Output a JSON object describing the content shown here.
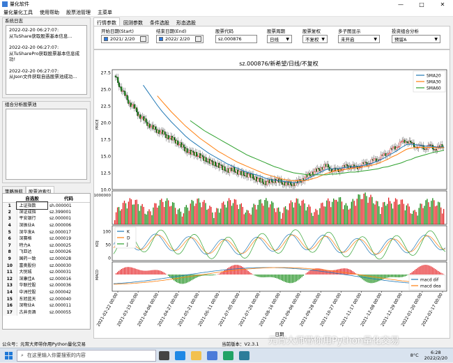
{
  "window": {
    "title": "量化软件",
    "min": "—",
    "max": "□",
    "close": "✕"
  },
  "menu": [
    "量化量化工具",
    "使用帮助",
    "股票池管理",
    "主菜单"
  ],
  "log_panel": {
    "title": "系统日志",
    "entries": [
      {
        "time": "2022-02-20 06:27:07:",
        "msg": "从TuShare获取股票基本信息..."
      },
      {
        "time": "2022-02-20 06:27:07:",
        "msg": "从TuSharePro获取股票基本信息成功!"
      },
      {
        "time": "2022-02-20 06:27:07:",
        "msg": "从Json文件获取自选股票池成功..."
      }
    ]
  },
  "combo_panel": {
    "title": "组合分析股票池"
  },
  "left_tabs": [
    "策略导航",
    "股票池索引"
  ],
  "stock_table": {
    "headers": [
      "",
      "自选股",
      "代码"
    ],
    "rows": [
      [
        "1",
        "上证指数",
        "sh.000001"
      ],
      [
        "2",
        "深证成指",
        "sz.399001"
      ],
      [
        "3",
        "平安银行",
        "sz.000001"
      ],
      [
        "4",
        "深振业A",
        "sz.000006"
      ],
      [
        "5",
        "深华发A",
        "sz.000017"
      ],
      [
        "6",
        "深赛格",
        "sz.000019"
      ],
      [
        "7",
        "特力A",
        "sz.000025"
      ],
      [
        "8",
        "飞亚达",
        "sz.000026"
      ],
      [
        "9",
        "国药一致",
        "sz.000028"
      ],
      [
        "10",
        "富奥股份",
        "sz.000030"
      ],
      [
        "11",
        "大悦城",
        "sz.000031"
      ],
      [
        "12",
        "深康佳A",
        "sz.000016"
      ],
      [
        "13",
        "华联控股",
        "sz.000036"
      ],
      [
        "14",
        "中洲控股",
        "sz.000042"
      ],
      [
        "15",
        "东旭蓝天",
        "sz.000040"
      ],
      [
        "16",
        "深物业A",
        "sz.000011"
      ],
      [
        "17",
        "古井贡酒",
        "sz.000055"
      ]
    ]
  },
  "main_tabs": [
    "行情参数",
    "回测参数",
    "条件选股",
    "形态选股"
  ],
  "controls": {
    "start_label": "开始日期(Start)",
    "start_value": "2021/ 2/20",
    "end_label": "结束日期(End)",
    "end_value": "2022/ 2/20",
    "code_label": "股票代码",
    "code_value": "sz.000876",
    "period_label": "股票周期",
    "period_value": "日线",
    "adjust_label": "股票复权",
    "adjust_value": "不复权",
    "multi_label": "多子图显示",
    "multi_value": "未开启",
    "portfolio_label": "投资组合分析",
    "portfolio_value": "预留A"
  },
  "chart_data": {
    "type": "line",
    "title": "sz.000876/新希望/日线/不复权",
    "xlabel": "日期",
    "price_ylabel": "PRICE",
    "kdj_ylabel": "KDJ",
    "macd_ylabel": "MACD",
    "x_ticks": [
      "2021-02-22 00:00",
      "2021-03-15 00:00",
      "2021-04-06 00:00",
      "2021-04-27 00:00",
      "2021-05-21 00:00",
      "2021-06-11 00:00",
      "2021-07-05 00:00",
      "2021-07-26 00:00",
      "2021-08-16 00:00",
      "2021-09-06 00:00",
      "2021-09-28 00:00",
      "2021-10-27 00:00",
      "2021-11-17 00:00",
      "2021-12-08 00:00",
      "2021-12-29 00:00",
      "2022-01-20 00:00",
      "2022-02-17 00:00"
    ],
    "price_ylim": [
      10.0,
      27.5
    ],
    "price_yticks": [
      "10.0",
      "12.5",
      "15.0",
      "17.5",
      "20.0",
      "22.5",
      "25.0",
      "27.5"
    ],
    "volume_ytick": "1000000",
    "kdj_yticks": [
      "100",
      "50",
      "0"
    ],
    "price": [
      27.0,
      25.5,
      24.2,
      23.0,
      22.3,
      21.2,
      20.5,
      19.8,
      19.2,
      18.8,
      18.5,
      18.0,
      17.6,
      17.2,
      16.6,
      16.0,
      15.5,
      15.4,
      15.0,
      14.6,
      14.2,
      13.9,
      13.6,
      13.2,
      12.8,
      13.1,
      12.6,
      12.4,
      12.2,
      12.0,
      11.6,
      11.3,
      11.0,
      11.2,
      11.4,
      11.2,
      11.0,
      10.8,
      10.9,
      11.1,
      11.6,
      12.0,
      12.6,
      12.8,
      13.3,
      13.5,
      13.0,
      12.8,
      13.1,
      13.4,
      13.6,
      13.2,
      13.5,
      13.8,
      14.0,
      14.3,
      14.6,
      15.0,
      15.5,
      16.0,
      16.5,
      17.0,
      17.4,
      16.8,
      16.5,
      16.4,
      16.2,
      16.5,
      16.1,
      16.3,
      16.6
    ],
    "series": [
      {
        "name": "SMA20",
        "color": "#1f77b4",
        "values": [
          null,
          null,
          null,
          null,
          null,
          null,
          25.6,
          24.6,
          23.6,
          22.6,
          21.7,
          20.9,
          20.1,
          19.4,
          18.7,
          18.0,
          17.4,
          16.9,
          16.4,
          15.9,
          15.4,
          15.0,
          14.6,
          14.2,
          13.8,
          13.5,
          13.2,
          12.9,
          12.6,
          12.4,
          12.2,
          12.0,
          11.7,
          11.5,
          11.4,
          11.3,
          11.2,
          11.1,
          11.0,
          11.1,
          11.3,
          11.6,
          12.0,
          12.3,
          12.7,
          13.0,
          13.1,
          13.1,
          13.2,
          13.3,
          13.4,
          13.4,
          13.5,
          13.6,
          13.8,
          14.0,
          14.3,
          14.6,
          15.0,
          15.4,
          15.8,
          16.3,
          16.7,
          16.8,
          16.7,
          16.6,
          16.5,
          16.5,
          16.4,
          16.3,
          16.4
        ]
      },
      {
        "name": "SMA30",
        "color": "#ff7f0e",
        "values": [
          null,
          null,
          null,
          null,
          null,
          null,
          null,
          null,
          null,
          24.0,
          23.2,
          22.4,
          21.6,
          20.9,
          20.2,
          19.5,
          18.9,
          18.3,
          17.7,
          17.2,
          16.7,
          16.2,
          15.7,
          15.3,
          14.9,
          14.5,
          14.1,
          13.8,
          13.5,
          13.2,
          12.9,
          12.6,
          12.3,
          12.1,
          11.9,
          11.7,
          11.5,
          11.4,
          11.3,
          11.3,
          11.3,
          11.4,
          11.6,
          11.8,
          12.1,
          12.4,
          12.6,
          12.8,
          12.9,
          13.0,
          13.1,
          13.2,
          13.3,
          13.4,
          13.5,
          13.7,
          13.9,
          14.2,
          14.5,
          14.9,
          15.2,
          15.6,
          16.0,
          16.2,
          16.3,
          16.3,
          16.3,
          16.3,
          16.3,
          16.2,
          16.3
        ]
      },
      {
        "name": "SMA60",
        "color": "#2ca02c",
        "values": [
          null,
          null,
          null,
          null,
          null,
          null,
          null,
          null,
          null,
          null,
          null,
          null,
          null,
          null,
          null,
          null,
          20.3,
          19.8,
          19.3,
          18.8,
          18.4,
          18.0,
          17.6,
          17.2,
          16.8,
          16.4,
          16.0,
          15.6,
          15.2,
          14.9,
          14.6,
          14.3,
          14.0,
          13.7,
          13.4,
          13.2,
          12.9,
          12.7,
          12.5,
          12.4,
          12.3,
          12.2,
          12.2,
          12.2,
          12.2,
          12.2,
          12.3,
          12.3,
          12.4,
          12.5,
          12.6,
          12.6,
          12.7,
          12.8,
          12.9,
          13.0,
          13.1,
          13.3,
          13.4,
          13.6,
          13.8,
          14.0,
          14.3,
          14.5,
          14.8,
          15.0,
          15.2,
          15.4,
          15.6,
          15.7,
          15.9
        ]
      }
    ],
    "kdj_legend": [
      {
        "name": "K",
        "color": "#1f77b4"
      },
      {
        "name": "D",
        "color": "#ff7f0e"
      },
      {
        "name": "J",
        "color": "#2ca02c"
      }
    ],
    "macd_legend": [
      {
        "name": "macd dif",
        "color": "#1f77b4"
      },
      {
        "name": "macd dea",
        "color": "#ff7f0e"
      }
    ],
    "up_color": "#e41a1c",
    "down_color": "#138a13"
  },
  "status": {
    "left": "公众号：元宵大师带你用Python量化交易",
    "right": "当前版本：V2.3.1"
  },
  "taskbar": {
    "search_placeholder": "在这里输入你要搜索的内容",
    "weather": "8°C",
    "time": "6:28",
    "date": "2022/2/20",
    "watermark": "元宵大师带你用Python量化交易"
  }
}
